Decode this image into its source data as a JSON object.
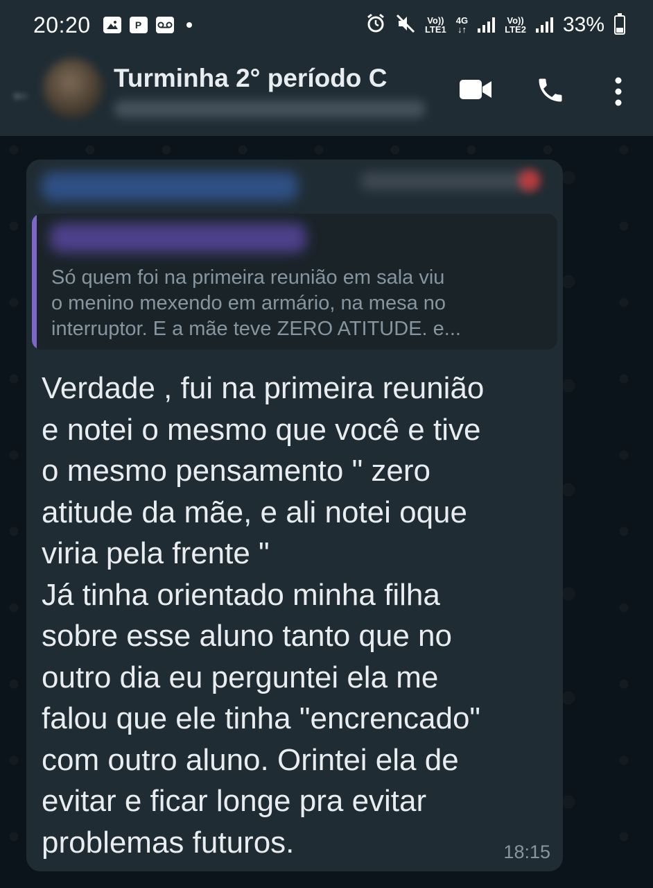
{
  "status_bar": {
    "time": "20:20",
    "left_icons": [
      "image-icon",
      "parking-notification-icon",
      "voicemail-icon"
    ],
    "right_icons": [
      "alarm-icon",
      "mute-icon",
      "volte-lte1-icon",
      "4g-data-icon",
      "signal-icon",
      "volte-lte2-icon",
      "signal-icon"
    ],
    "lte1_top": "Vo))",
    "lte1_bottom": "LTE1",
    "net_top": "4G",
    "net_bottom": "↓↑",
    "lte2_top": "Vo))",
    "lte2_bottom": "LTE2",
    "battery": "33%"
  },
  "header": {
    "title": "Turminha 2° período C",
    "icons": [
      "back-arrow-icon",
      "video-call-icon",
      "voice-call-icon",
      "more-options-icon"
    ]
  },
  "message": {
    "quoted_text": "Só quem foi na primeira reunião em sala viu\no menino mexendo em armário, na mesa no\ninterruptor. E a mãe teve ZERO ATITUDE.  e...",
    "text": "Verdade , fui na primeira reunião\ne notei o mesmo que você e tive\no mesmo pensamento \" zero\natitude da mãe, e ali notei oque\nviria pela frente \"\nJá tinha orientado minha filha\nsobre esse aluno tanto que no\noutro dia eu perguntei ela me\nfalou que ele tinha \"encrencado\"\ncom outro aluno. Orintei ela de\nevitar e ficar longe pra evitar\nproblemas futuros.",
    "time": "18:15"
  },
  "colors": {
    "background": "#0b141a",
    "header": "#1f2c34",
    "bubble": "#202c33",
    "quote_bar": "#7f66c9",
    "text": "#e9edef",
    "muted": "#8696a0"
  }
}
